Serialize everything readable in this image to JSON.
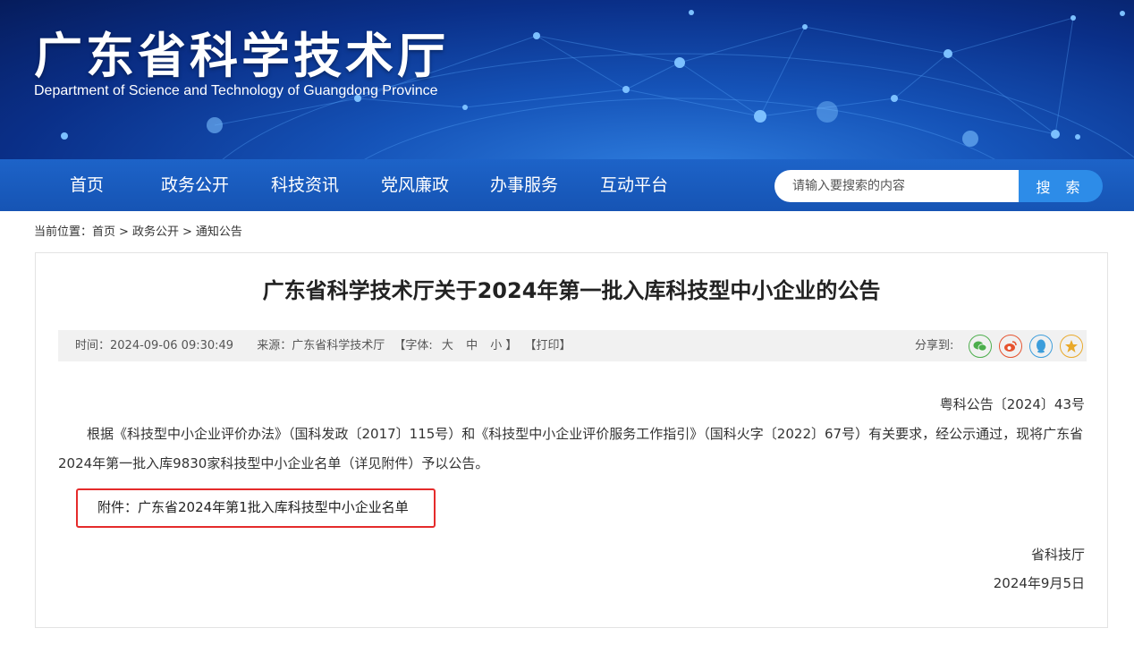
{
  "header": {
    "title": "广东省科学技术厅",
    "subtitle": "Department of Science and Technology of Guangdong Province"
  },
  "nav": {
    "items": [
      "首页",
      "政务公开",
      "科技资讯",
      "党风廉政",
      "办事服务",
      "互动平台"
    ]
  },
  "search": {
    "placeholder": "请输入要搜索的内容",
    "button_label": "搜 索"
  },
  "breadcrumb": {
    "prefix": "当前位置：",
    "items": [
      "首页",
      "政务公开",
      "通知公告"
    ],
    "separator": ">"
  },
  "article": {
    "title": "广东省科学技术厅关于2024年第一批入库科技型中小企业的公告",
    "meta": {
      "time": "时间：2024-09-06 09:30:49",
      "source": "来源：广东省科学技术厅",
      "font_label": "【字体:",
      "font_sizes": [
        "大",
        "中",
        "小"
      ],
      "font_close": "】",
      "print": "【打印】",
      "share_label": "分享到:"
    },
    "doc_number": "粤科公告〔2024〕43号",
    "paragraph": "根据《科技型中小企业评价办法》（国科发政〔2017〕115号）和《科技型中小企业评价服务工作指引》（国科火字〔2022〕67号）有关要求，经公示通过，现将广东省2024年第一批入库9830家科技型中小企业名单（详见附件）予以公告。",
    "attachment": "附件：广东省2024年第1批入库科技型中小企业名单",
    "signature": "省科技厅",
    "date": "2024年9月5日"
  },
  "share_icons": [
    {
      "name": "wechat-icon",
      "color": "#4cae4c"
    },
    {
      "name": "weibo-icon",
      "color": "#e6532f"
    },
    {
      "name": "qq-icon",
      "color": "#3c9ddb"
    },
    {
      "name": "favorite-icon",
      "color": "#e9a92a"
    }
  ],
  "colors": {
    "nav_bg": "#1654b4",
    "search_button": "#2d8ce8",
    "highlight_box": "#e52b2b"
  }
}
